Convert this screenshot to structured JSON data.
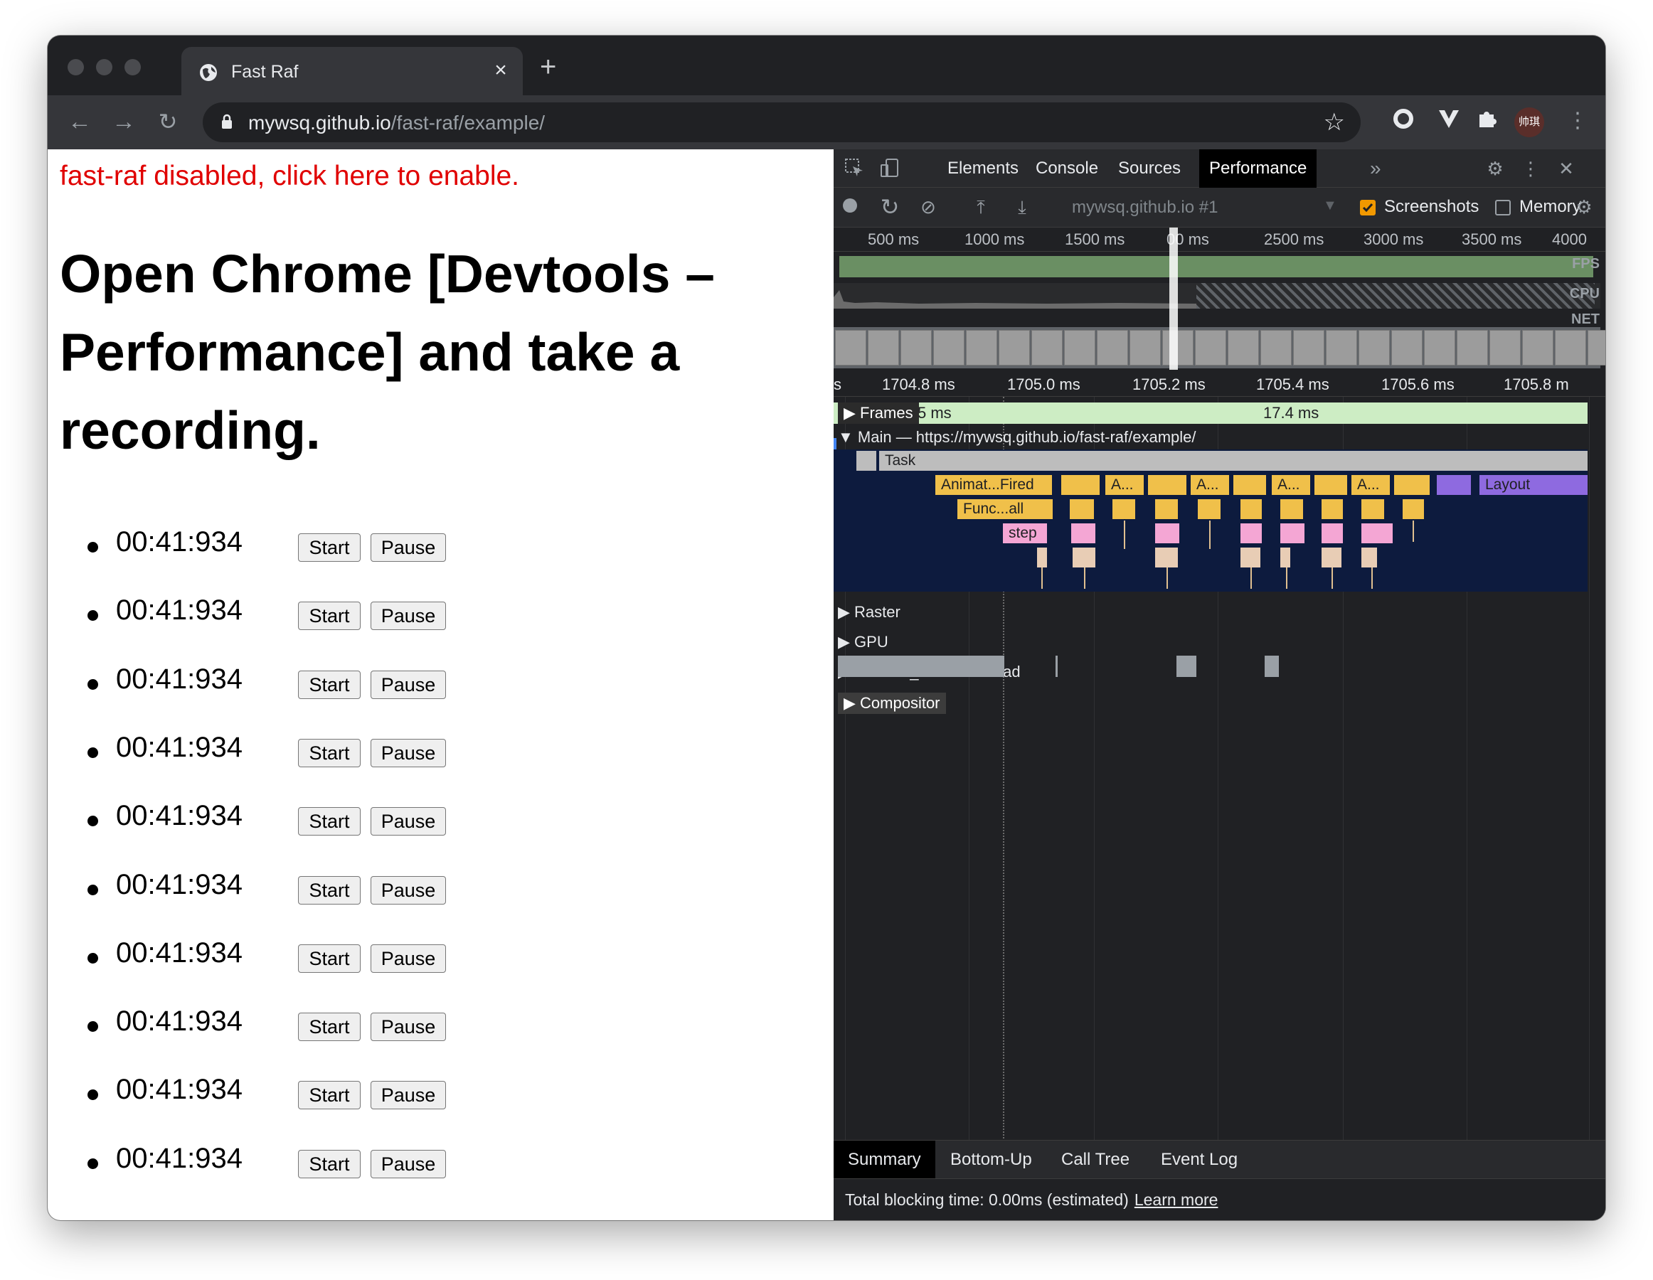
{
  "browser": {
    "tab_title": "Fast Raf",
    "url_host": "mywsq.github.io",
    "url_path": "/fast-raf/example/",
    "new_tab": "+",
    "close_tab": "×",
    "avatar_text": "帅琪"
  },
  "page": {
    "toggle_text": "fast-raf disabled, click here to enable.",
    "heading": "Open Chrome [Devtools – Performance] and take a recording.",
    "start_label": "Start",
    "pause_label": "Pause",
    "timers": [
      "00:41:934",
      "00:41:934",
      "00:41:934",
      "00:41:934",
      "00:41:934",
      "00:41:934",
      "00:41:934",
      "00:41:934",
      "00:41:934",
      "00:41:934"
    ]
  },
  "devtools": {
    "tabs": [
      "Elements",
      "Console",
      "Sources",
      "Performance"
    ],
    "active_tab": "Performance",
    "more_tabs": "»",
    "profile_select": "mywsq.github.io #1",
    "screenshots_label": "Screenshots",
    "screenshots_checked": true,
    "memory_label": "Memory",
    "memory_checked": false,
    "overview_ticks": [
      "500 ms",
      "1000 ms",
      "1500 ms",
      "00 ms",
      "2500 ms",
      "3000 ms",
      "3500 ms",
      "4000"
    ],
    "lane_labels": {
      "fps": "FPS",
      "cpu": "CPU",
      "net": "NET"
    },
    "detail_ticks": [
      "s",
      "1704.8 ms",
      "1705.0 ms",
      "1705.2 ms",
      "1705.4 ms",
      "1705.6 ms",
      "1705.8 m"
    ],
    "frames_label": "Frames",
    "frames_small": "5 ms",
    "frames_duration": "17.4 ms",
    "main_header": "Main — https://mywsq.github.io/fast-raf/example/",
    "flame": {
      "task": "Task",
      "anim_fired": "Animat...Fired",
      "anim_short": [
        "A...",
        "A...",
        "A...",
        "A..."
      ],
      "func_call": "Func...all",
      "step": "step",
      "layout": "Layout"
    },
    "tracks": [
      "Raster",
      "GPU",
      "Chrome_ChildIOThread",
      "Compositor"
    ],
    "bottom_tabs": [
      "Summary",
      "Bottom-Up",
      "Call Tree",
      "Event Log"
    ],
    "active_bottom_tab": "Summary",
    "status_text": "Total blocking time: 0.00ms (estimated)",
    "learn_more": "Learn more",
    "colors": {
      "accent_checkbox": "#f29900",
      "fps_green": "#6a8f63",
      "layout_purple": "#8e6ae0",
      "script_yellow": "#f0c04a",
      "step_pink": "#f4a6d4"
    }
  }
}
